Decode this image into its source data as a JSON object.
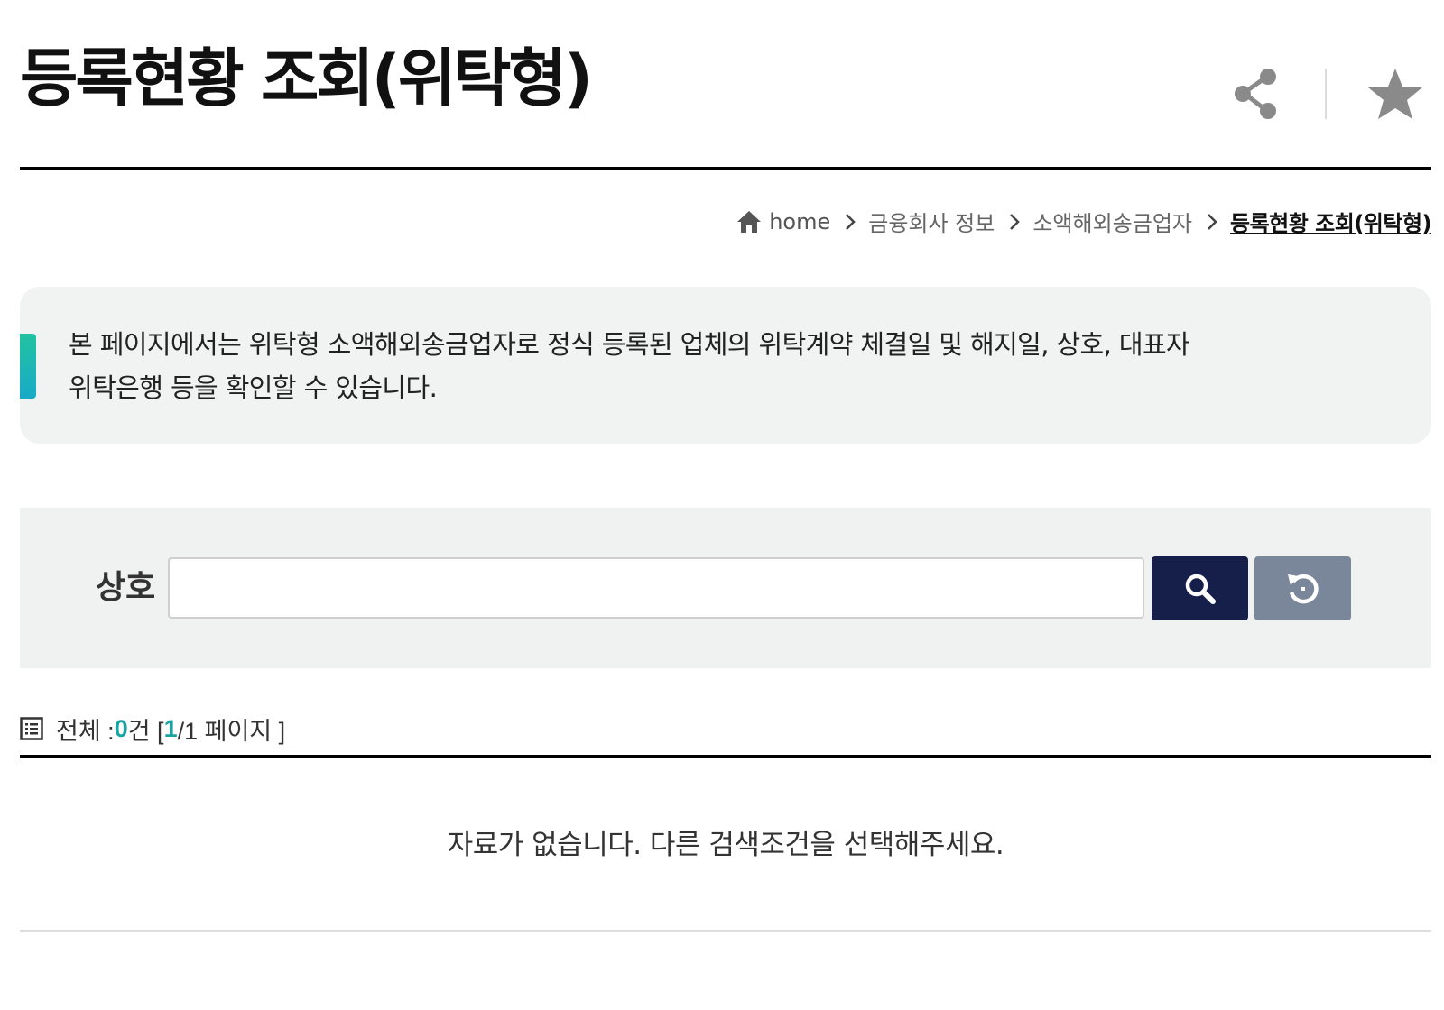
{
  "header": {
    "title": "등록현황 조회(위탁형)",
    "share_icon": "share-icon",
    "favorite_icon": "star-icon"
  },
  "breadcrumb": {
    "home": "home",
    "items": [
      "금융회사 정보",
      "소액해외송금업자"
    ],
    "current": "등록현황 조회(위탁형)"
  },
  "info": {
    "line1": "본 페이지에서는 위탁형 소액해외송금업자로 정식 등록된 업체의 위탁계약 체결일 및 해지일, 상호, 대표자",
    "line2": "위탁은행 등을 확인할 수 있습니다."
  },
  "search": {
    "label": "상호",
    "value": "",
    "placeholder": "",
    "search_icon": "search-icon",
    "reset_icon": "reset-icon"
  },
  "summary": {
    "prefix": "전체 :",
    "count": "0",
    "count_unit": "건 [",
    "page_current": "1",
    "page_suffix": "/1 페이지 ]"
  },
  "results": {
    "empty_message": "자료가 없습니다. 다른 검색조건을 선택해주세요."
  },
  "colors": {
    "primary_button": "#151f4a",
    "reset_button": "#7a8699",
    "accent": "#1aa3a3",
    "info_bar_start": "#22c2a0",
    "info_bar_end": "#18aac8"
  }
}
